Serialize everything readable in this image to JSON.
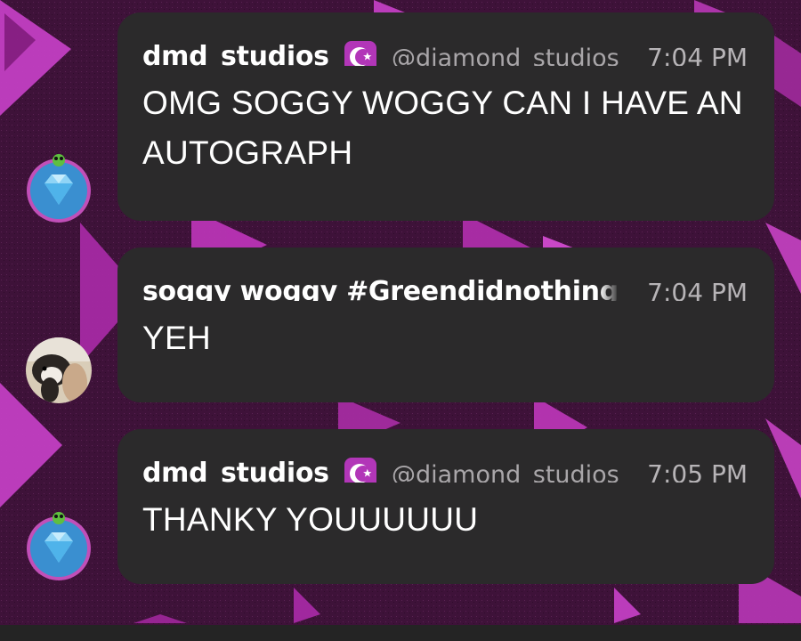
{
  "messages": [
    {
      "username": "dmd_studios",
      "handle": "@diamond_studios",
      "time": "7:04 PM",
      "text": "OMG SOGGY WOGGY CAN I HAVE AN AUTOGRAPH",
      "avatar": "diamond-avatar",
      "badge": "crescent-star-icon"
    },
    {
      "username": "soggy woggy #Greendidnothing",
      "time": "7:04 PM",
      "text": "YEH",
      "avatar": "guinea-pig-avatar"
    },
    {
      "username": "dmd_studios",
      "handle": "@diamond_studios",
      "time": "7:05 PM",
      "text": "THANKY YOUUUUUU",
      "avatar": "diamond-avatar",
      "badge": "crescent-star-icon"
    }
  ],
  "colors": {
    "background": "#4a1646",
    "accent_pink": "#c23fc2",
    "bubble": "#2b2a2b",
    "handle_text": "#a9a6a9",
    "badge": "#b236b8"
  }
}
